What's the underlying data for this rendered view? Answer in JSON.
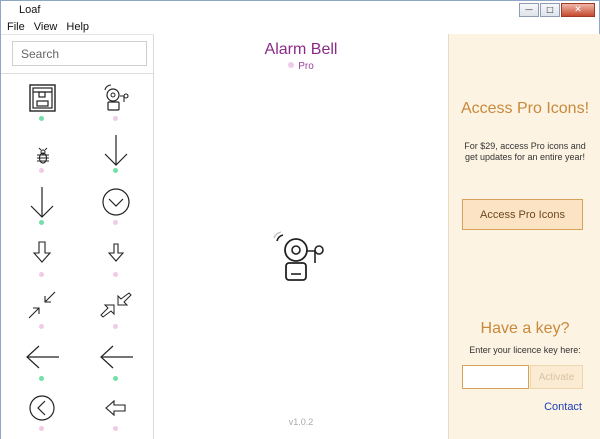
{
  "window": {
    "title": "Loaf",
    "controls": [
      "minimize",
      "maximize",
      "close"
    ]
  },
  "menu": {
    "items": [
      "File",
      "View",
      "Help"
    ]
  },
  "sidebar": {
    "search": {
      "placeholder": "Search",
      "value": ""
    },
    "icons": [
      {
        "name": "3d-printer-icon",
        "tier": "free"
      },
      {
        "name": "alarm-bell-icon",
        "tier": "pro"
      },
      {
        "name": "bug-icon",
        "tier": "pro"
      },
      {
        "name": "arrow-down-icon",
        "tier": "free"
      },
      {
        "name": "arrow-down-long-icon",
        "tier": "free"
      },
      {
        "name": "arrow-down-circle-icon",
        "tier": "pro"
      },
      {
        "name": "arrow-down-outline-icon",
        "tier": "pro"
      },
      {
        "name": "arrow-down-outline-small-icon",
        "tier": "pro"
      },
      {
        "name": "arrows-collapse-icon",
        "tier": "pro"
      },
      {
        "name": "arrows-collapse-outline-icon",
        "tier": "pro"
      },
      {
        "name": "arrow-left-icon",
        "tier": "free"
      },
      {
        "name": "arrow-left-thin-icon",
        "tier": "free"
      },
      {
        "name": "arrow-left-circle-icon",
        "tier": "pro"
      },
      {
        "name": "arrow-left-outline-icon",
        "tier": "pro"
      }
    ],
    "colors": {
      "free": "#73e0a7",
      "pro": "#efcbe8"
    }
  },
  "detail": {
    "title": "Alarm Bell",
    "tier_label": "Pro",
    "preview_icon": "alarm-bell-icon",
    "version": "v1.0.2"
  },
  "promo": {
    "title": "Access Pro Icons!",
    "description": "For $29, access Pro icons and get updates for an entire year!",
    "button_label": "Access Pro Icons",
    "key_title": "Have a key?",
    "key_label": "Enter your licence key here:",
    "key_value": "",
    "activate_label": "Activate",
    "contact_label": "Contact",
    "accent_color": "#c7893b"
  }
}
